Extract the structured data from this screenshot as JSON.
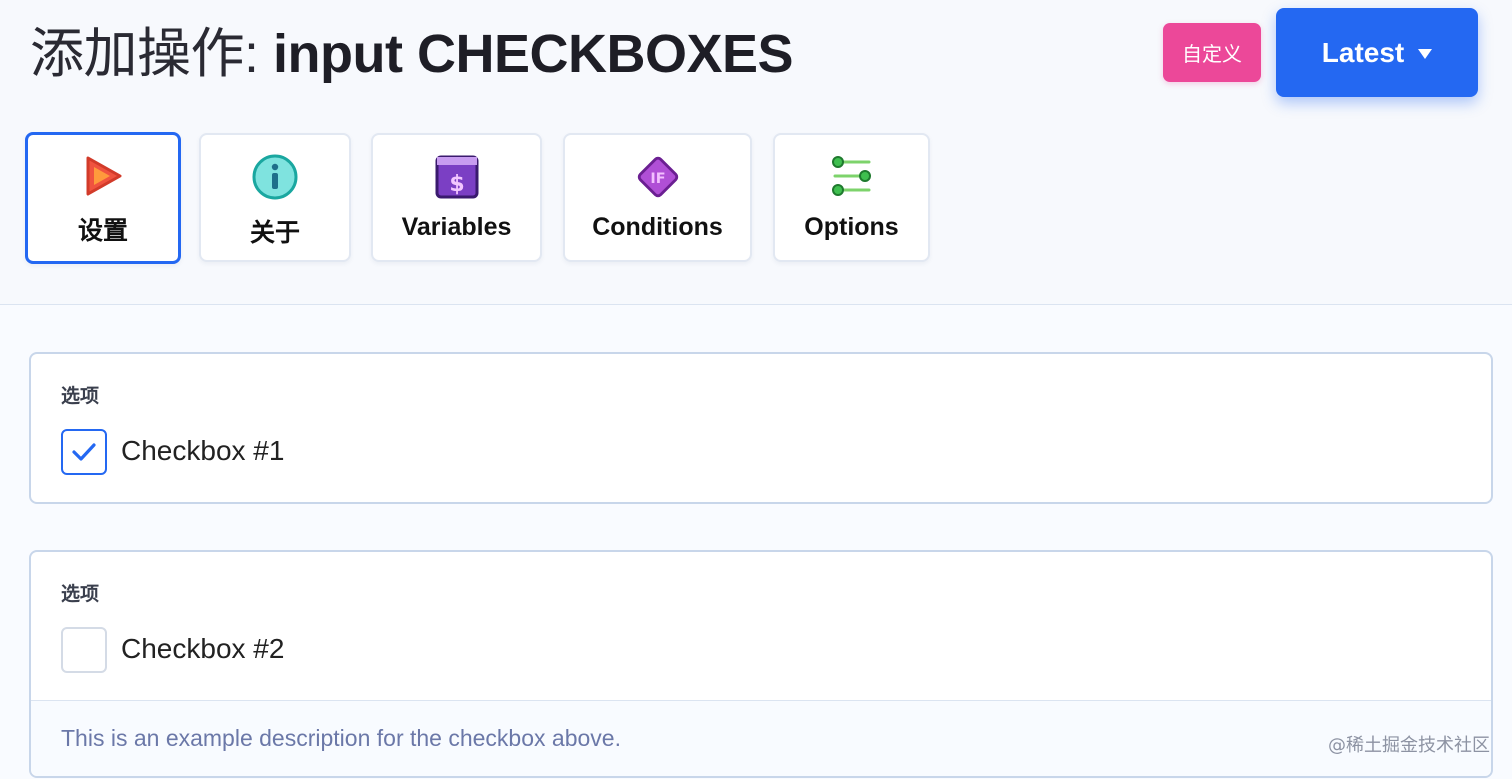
{
  "header": {
    "title_prefix": "添加操作:",
    "title_name": "input CHECKBOXES",
    "custom_button": "自定义",
    "version_button": "Latest"
  },
  "tabs": [
    {
      "label": "设置",
      "icon": "play-icon",
      "active": true
    },
    {
      "label": "关于",
      "icon": "info-icon",
      "active": false
    },
    {
      "label": "Variables",
      "icon": "dollar-icon",
      "active": false
    },
    {
      "label": "Conditions",
      "icon": "if-icon",
      "active": false
    },
    {
      "label": "Options",
      "icon": "sliders-icon",
      "active": false
    }
  ],
  "fields": [
    {
      "label": "选项",
      "checkbox_label": "Checkbox #1",
      "checked": true
    },
    {
      "label": "选项",
      "checkbox_label": "Checkbox #2",
      "checked": false,
      "description": "This is an example description for the checkbox above."
    }
  ],
  "watermark": "@稀土掘金技术社区",
  "colors": {
    "accent": "#2468f2",
    "custom_button": "#ec4899",
    "description_text": "#6b78a8"
  }
}
